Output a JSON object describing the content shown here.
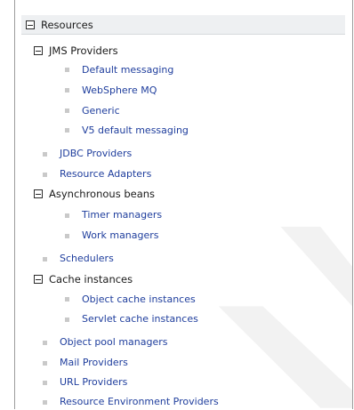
{
  "tree": {
    "root": {
      "label": "Resources",
      "expanded": true
    },
    "jms": {
      "label": "JMS Providers",
      "children": [
        "Default messaging",
        "WebSphere MQ",
        "Generic",
        "V5 default messaging"
      ]
    },
    "jdbc": "JDBC Providers",
    "adapters": "Resource Adapters",
    "async": {
      "label": "Asynchronous beans",
      "children": [
        "Timer managers",
        "Work managers"
      ]
    },
    "schedulers": "Schedulers",
    "cache": {
      "label": "Cache instances",
      "children": [
        "Object cache instances",
        "Servlet cache instances"
      ]
    },
    "pool": "Object pool managers",
    "mail": "Mail Providers",
    "url": "URL Providers",
    "env": "Resource Environment Providers"
  },
  "colors": {
    "link": "#1f3e9d",
    "category": "#1a1a1a",
    "header_bg": "#eef0f2",
    "bullet": "#c9c9c9"
  }
}
